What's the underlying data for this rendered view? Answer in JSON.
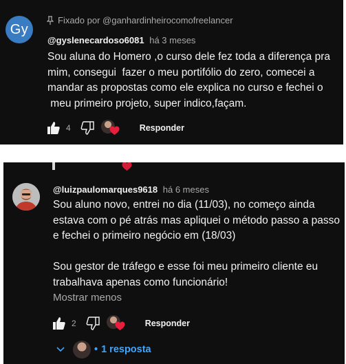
{
  "comments": [
    {
      "avatar_initials": "Gy",
      "pinned_label": "Fixado por @ganhardinheirocomofreelancer",
      "author": "@gyslenecardoso6081",
      "time": "há 3 meses",
      "body": "Sou aluna do Homero ,o curso dele fez toda a diferença pra\nmim, consegui  fazer o meu portifólio do zero, comecei a\nmandar as propostas como ele explica no curso e fechei o\n meu primeiro projeto, super indico,façam.",
      "likes": "4",
      "reply_label": "Responder"
    },
    {
      "author": "@luizpaulomarques9618",
      "time": "há 6 meses",
      "body": "Sou aluno novo, entrei no dia (11/03), no começo ainda\nestava com o pé atrás mas apliquei o método passo a passo\ne fechei o primeiro negócio em (18/03)\n\nSou gestor de tráfego e esse foi meu primeiro cliente eu\ntrabalhava apenas como funcionário!",
      "show_less": "Mostrar menos",
      "likes": "2",
      "reply_label": "Responder",
      "replies_label": "1 resposta"
    }
  ],
  "colors": {
    "background": "#0f0f0f",
    "text": "#f1f1f1",
    "secondary_text": "#aaaaaa",
    "link": "#3ea6ff",
    "heart": "#e91e3c",
    "gy_avatar": "#3a7cc2"
  }
}
